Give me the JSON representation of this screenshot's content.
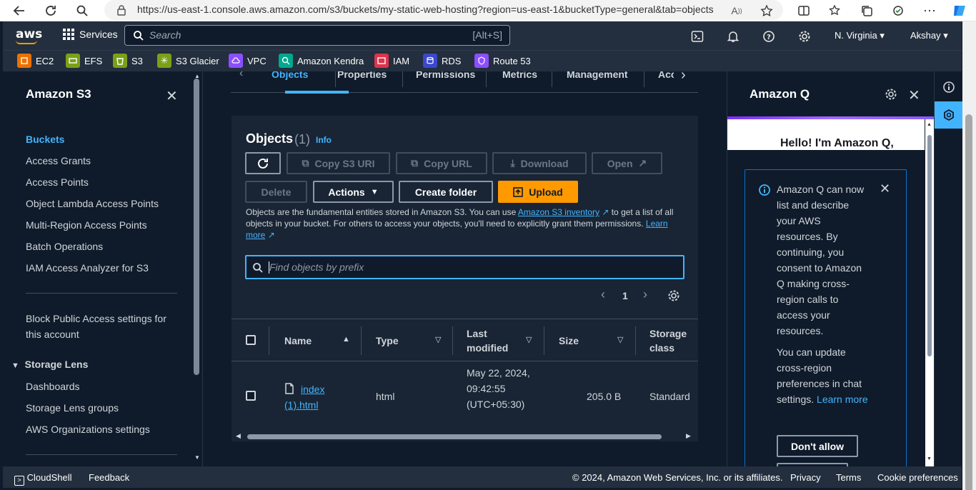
{
  "browser": {
    "url": "https://us-east-1.console.aws.amazon.com/s3/buckets/my-static-web-hosting?region=us-east-1&bucketType=general&tab=objects"
  },
  "top_nav": {
    "logo": "aws",
    "services_label": "Services",
    "search_placeholder": "Search",
    "search_shortcut": "[Alt+S]",
    "region": "N. Virginia",
    "user": "Akshay"
  },
  "favorites": [
    {
      "label": "EC2",
      "color": "#ed7100"
    },
    {
      "label": "EFS",
      "color": "#7aa116"
    },
    {
      "label": "S3",
      "color": "#7aa116"
    },
    {
      "label": "S3 Glacier",
      "color": "#7aa116"
    },
    {
      "label": "VPC",
      "color": "#8c4fff"
    },
    {
      "label": "Amazon Kendra",
      "color": "#01a88d"
    },
    {
      "label": "IAM",
      "color": "#dd344c"
    },
    {
      "label": "RDS",
      "color": "#3b48cc"
    },
    {
      "label": "Route 53",
      "color": "#8c4fff"
    }
  ],
  "sidebar": {
    "title": "Amazon S3",
    "items": [
      {
        "label": "Buckets"
      },
      {
        "label": "Access Grants"
      },
      {
        "label": "Access Points"
      },
      {
        "label": "Object Lambda Access Points"
      },
      {
        "label": "Multi-Region Access Points"
      },
      {
        "label": "Batch Operations"
      },
      {
        "label": "IAM Access Analyzer for S3"
      }
    ],
    "block_public_access": "Block Public Access settings for this account",
    "storage_lens": {
      "label": "Storage Lens",
      "items": [
        "Dashboards",
        "Storage Lens groups",
        "AWS Organizations settings"
      ]
    }
  },
  "tabs": [
    "Objects",
    "Properties",
    "Permissions",
    "Metrics",
    "Management",
    "Acc"
  ],
  "objects_panel": {
    "title": "Objects",
    "count": "(1)",
    "info": "Info",
    "buttons": {
      "refresh": "",
      "copy_uri": "Copy S3 URI",
      "copy_url": "Copy URL",
      "download": "Download",
      "open": "Open",
      "delete": "Delete",
      "actions": "Actions",
      "create_folder": "Create folder",
      "upload": "Upload"
    },
    "desc_prefix": "Objects are the fundamental entities stored in Amazon S3. You can use ",
    "desc_link": "Amazon S3 inventory",
    "desc_suffix": " to get a list of all objects in your bucket. For others to access your objects, you'll need to explicitly grant them permissions. ",
    "learn_more": "Learn more",
    "find_placeholder": "Find objects by prefix",
    "page": "1"
  },
  "table": {
    "columns": [
      "Name",
      "Type",
      "Last modified",
      "Size",
      "Storage class"
    ],
    "rows": [
      {
        "name": "index (1).html",
        "type": "html",
        "last_modified": "May 22, 2024, 09:42:55 (UTC+05:30)",
        "size": "205.0 B",
        "storage_class": "Standard"
      }
    ]
  },
  "amazon_q": {
    "title": "Amazon Q",
    "hello": "Hello! I'm Amazon Q,",
    "info_p1": "Amazon Q can now list and describe your AWS resources. By continuing, you consent to Amazon Q making cross-region calls to access your resources.",
    "info_p2": "You can update cross-region preferences in chat settings. ",
    "info_link": "Learn more",
    "dont_allow": "Don't allow"
  },
  "footer": {
    "cloudshell": "CloudShell",
    "feedback": "Feedback",
    "copyright": "© 2024, Amazon Web Services, Inc. or its affiliates.",
    "privacy": "Privacy",
    "terms": "Terms",
    "cookies": "Cookie preferences"
  }
}
